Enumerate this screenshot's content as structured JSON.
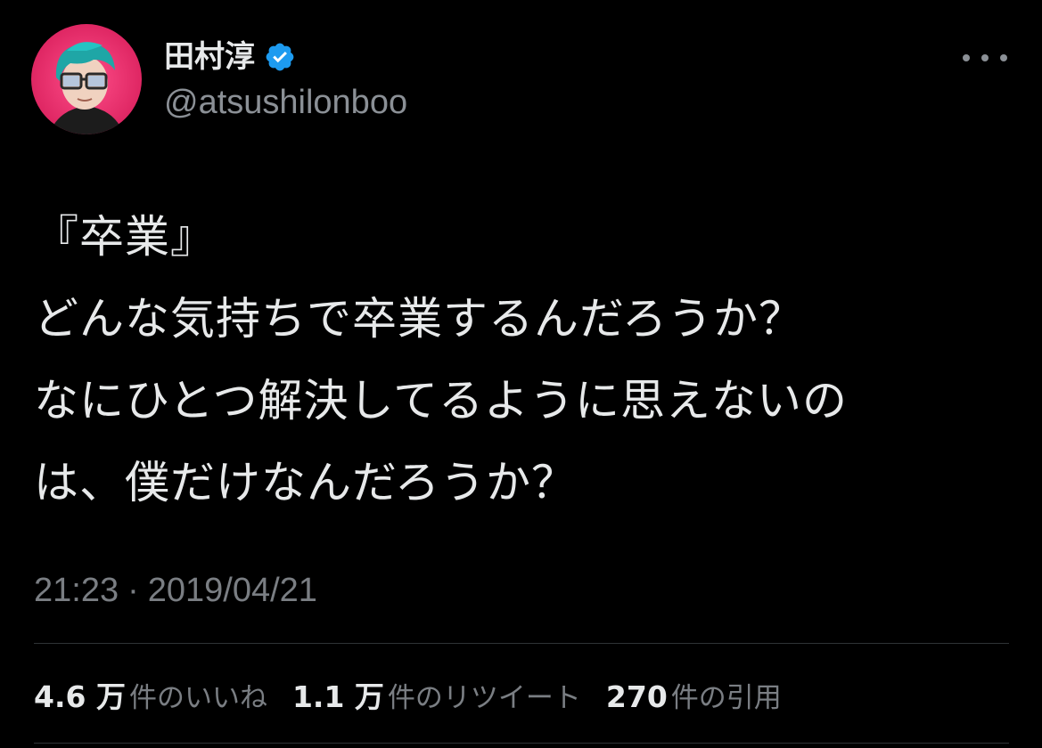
{
  "author": {
    "display_name": "田村淳",
    "handle": "@atsushilonboo",
    "verified": true,
    "avatar_icon": "profile-avatar"
  },
  "menu": {
    "more_icon": "more-horizontal-icon"
  },
  "tweet": {
    "lines": [
      "『卒業』",
      "どんな気持ちで卒業するんだろうか？",
      "なにひとつ解決してるように思えないの",
      "は、僕だけなんだろうか？"
    ]
  },
  "meta": {
    "time": "21:23",
    "separator": "·",
    "date": "2019/04/21"
  },
  "stats": {
    "likes": {
      "value": "4.6 万",
      "label": "件のいいね"
    },
    "retweets": {
      "value": "1.1 万",
      "label": "件のリツイート"
    },
    "quotes": {
      "value": "270",
      "label": "件の引用"
    }
  },
  "colors": {
    "background": "#000000",
    "primary_text": "#e7e9ea",
    "secondary_text": "#7a7e83",
    "verified_badge": "#1d9bf0",
    "divider": "#2f3336"
  }
}
